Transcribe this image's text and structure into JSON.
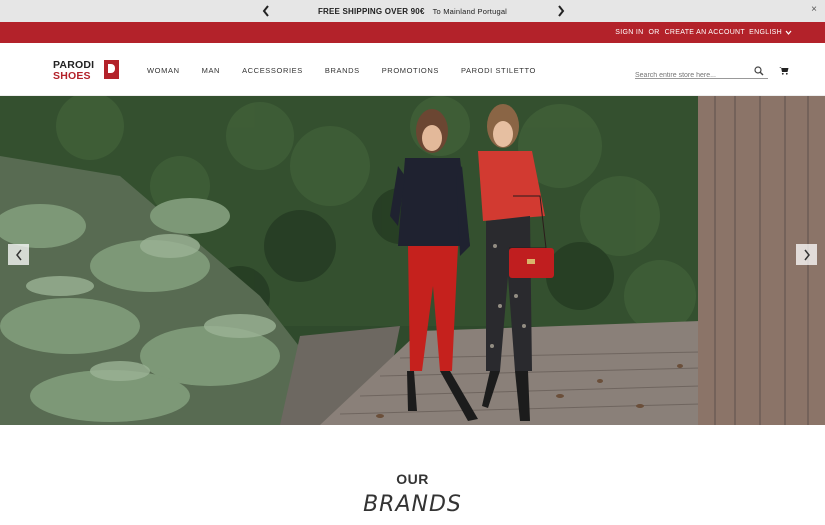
{
  "promo": {
    "headline": "FREE SHIPPING OVER 90€",
    "subline": "To Mainland Portugal",
    "close_label": "×"
  },
  "account": {
    "sign_in": "SIGN IN",
    "or": "OR",
    "create_account": "CREATE AN ACCOUNT",
    "language": "ENGLISH"
  },
  "logo": {
    "line1": "PARODI",
    "line2": "SHOES"
  },
  "nav": {
    "items": [
      "WOMAN",
      "MAN",
      "ACCESSORIES",
      "BRANDS",
      "PROMOTIONS",
      "PARODI STILETTO"
    ]
  },
  "search": {
    "placeholder": "Search entire store here..."
  },
  "icons": {
    "prev": "chevron-left-icon",
    "next": "chevron-right-icon",
    "search": "search-icon",
    "cart": "cart-icon",
    "close": "close-icon",
    "language_dropdown": "chevron-down-icon"
  },
  "colors": {
    "brand_red": "#b3222a",
    "promo_bg": "#e6e6e6"
  },
  "section": {
    "our": "OUR",
    "brands": "BRANDS"
  }
}
